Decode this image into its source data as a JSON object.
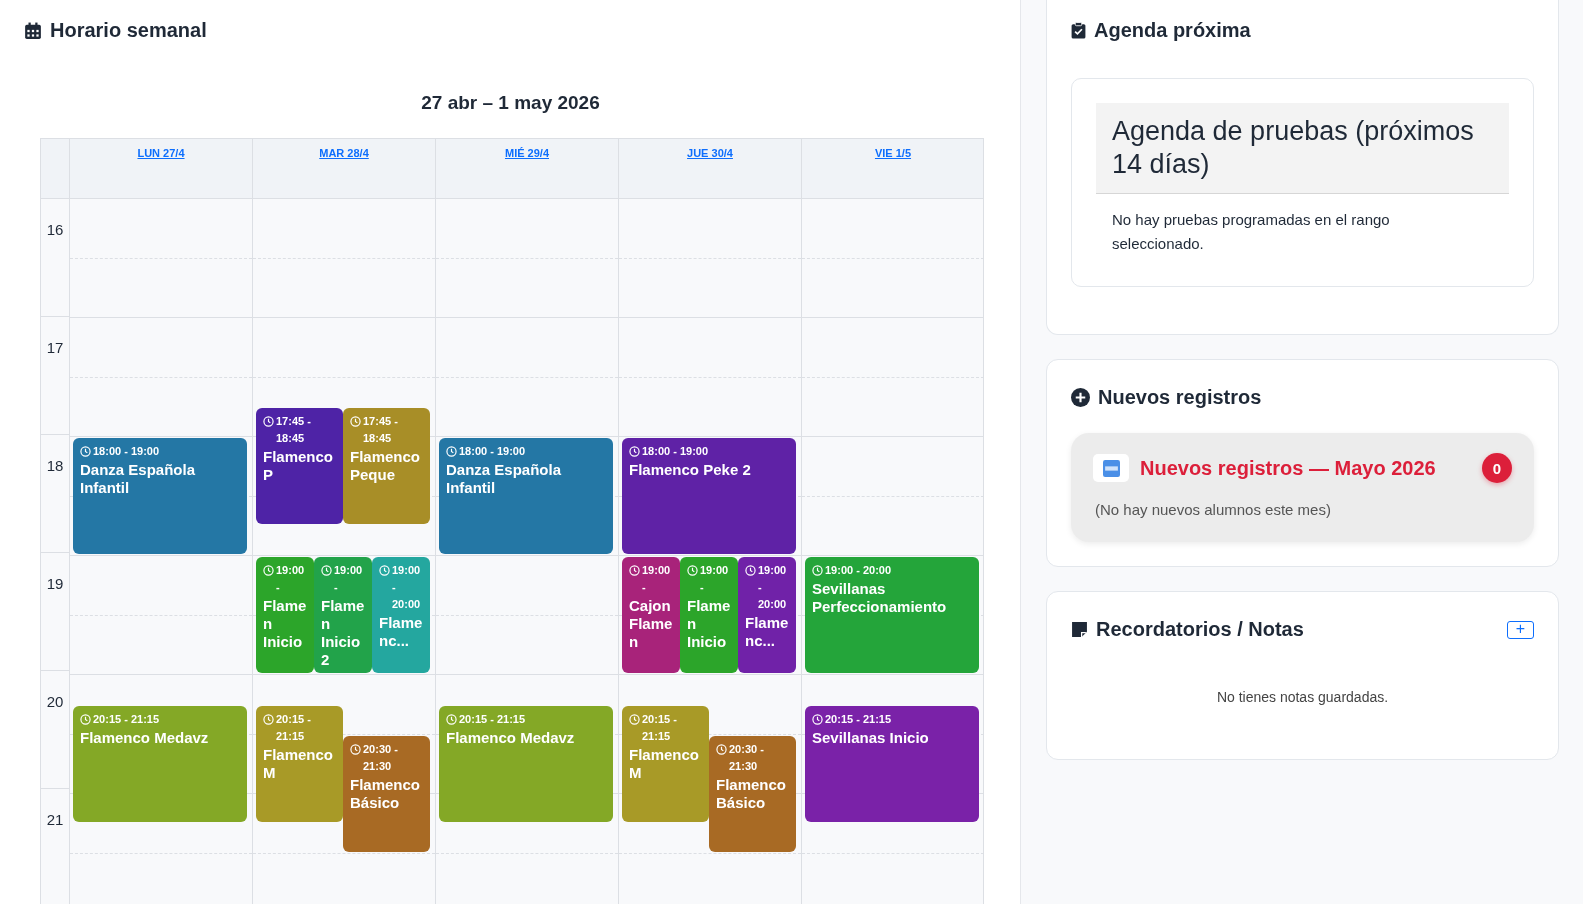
{
  "schedule": {
    "title": "Horario semanal",
    "range": "27 abr – 1 may 2026",
    "hours": [
      "16",
      "17",
      "18",
      "19",
      "20",
      "21"
    ],
    "days": [
      {
        "label": "LUN 27/4",
        "events": [
          {
            "time": "18:00 - 19:00",
            "title": "Danza Española Infantil",
            "color": "#2477a5"
          },
          {
            "time": "20:15 - 21:15",
            "title": "Flamenco Medavz",
            "color": "#84a826"
          }
        ]
      },
      {
        "label": "MAR 28/4",
        "events": [
          {
            "time": "17:45 - 18:45",
            "title": "Flamenco P",
            "color": "#4e23a6"
          },
          {
            "time": "17:45 - 18:45",
            "title": "Flamenco Peque",
            "color": "#a88e27"
          },
          {
            "time": "19:00 -",
            "title": "Flamen Inicio",
            "color": "#2ca52a"
          },
          {
            "time": "19:00 -",
            "title": "Flamen Inicio 2",
            "color": "#22a34a"
          },
          {
            "time": "19:00 - 20:00",
            "title": "Flamenc...",
            "color": "#24a79f"
          },
          {
            "time": "20:15 - 21:15",
            "title": "Flamenco M",
            "color": "#a89a27"
          },
          {
            "time": "20:30 - 21:30",
            "title": "Flamenco Básico",
            "color": "#a86a24"
          }
        ]
      },
      {
        "label": "MIÉ 29/4",
        "events": [
          {
            "time": "18:00 - 19:00",
            "title": "Danza Española Infantil",
            "color": "#2477a5"
          },
          {
            "time": "20:15 - 21:15",
            "title": "Flamenco Medavz",
            "color": "#84a826"
          }
        ]
      },
      {
        "label": "JUE 30/4",
        "events": [
          {
            "time": "18:00 - 19:00",
            "title": "Flamenco Peke 2",
            "color": "#5f22a6"
          },
          {
            "time": "19:00 -",
            "title": "Cajon Flamen",
            "color": "#a8237a"
          },
          {
            "time": "19:00 -",
            "title": "Flamen Inicio",
            "color": "#2ca52a"
          },
          {
            "time": "19:00 - 20:00",
            "title": "Flamenc...",
            "color": "#7022a8"
          },
          {
            "time": "20:15 - 21:15",
            "title": "Flamenco M",
            "color": "#a89a27"
          },
          {
            "time": "20:30 - 21:30",
            "title": "Flamenco Básico",
            "color": "#a86a24"
          }
        ]
      },
      {
        "label": "VIE 1/5",
        "events": [
          {
            "time": "19:00 - 20:00",
            "title": "Sevillanas Perfeccionamiento",
            "color": "#24a53a"
          },
          {
            "time": "20:15 - 21:15",
            "title": "Sevillanas Inicio",
            "color": "#7a22a8"
          }
        ]
      }
    ]
  },
  "agenda": {
    "title": "Agenda próxima",
    "heading": "Agenda de pruebas (próximos 14 días)",
    "message": "No hay pruebas programadas en el rango seleccionado."
  },
  "registrations": {
    "title": "Nuevos registros",
    "heading": "Nuevos registros — Mayo 2026",
    "count": "0",
    "message": "(No hay nuevos alumnos este mes)"
  },
  "notes": {
    "title": "Recordatorios / Notas",
    "add_button": "+",
    "message": "No tienes notas guardadas."
  }
}
